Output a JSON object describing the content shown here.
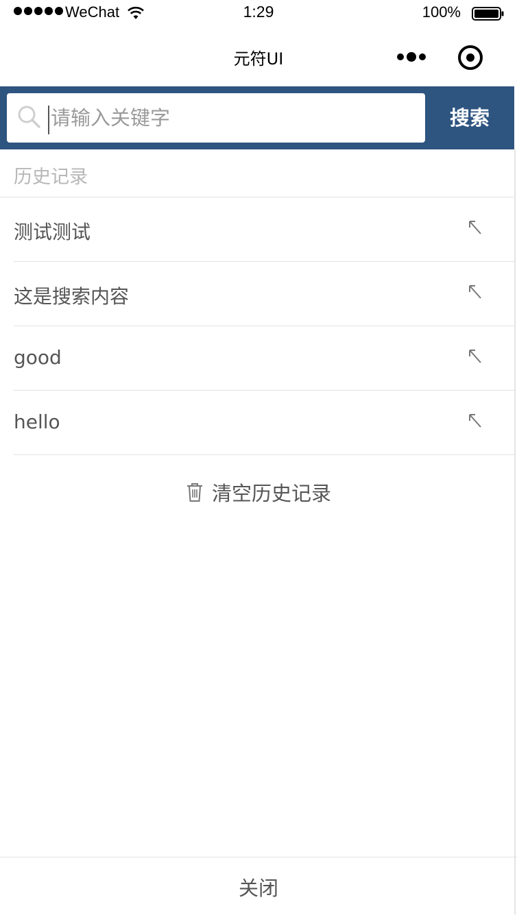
{
  "status_bar": {
    "carrier": "WeChat",
    "time": "1:29",
    "battery_percent": "100%",
    "icons": [
      "signal-dots-icon",
      "wifi-icon",
      "battery-icon"
    ]
  },
  "nav": {
    "title": "元符UI",
    "icons": [
      "more-icon",
      "target-icon"
    ]
  },
  "search": {
    "placeholder": "请输入关键字",
    "button_label": "搜索",
    "bar_color": "#2e5480",
    "icon": "search-icon"
  },
  "history": {
    "title": "历史记录",
    "items": [
      {
        "label": "测试测试"
      },
      {
        "label": "这是搜索内容"
      },
      {
        "label": "good"
      },
      {
        "label": "hello"
      }
    ],
    "item_icon": "fill-arrow-icon",
    "clear_label": "清空历史记录",
    "clear_icon": "trash-icon"
  },
  "footer": {
    "close_label": "关闭"
  }
}
